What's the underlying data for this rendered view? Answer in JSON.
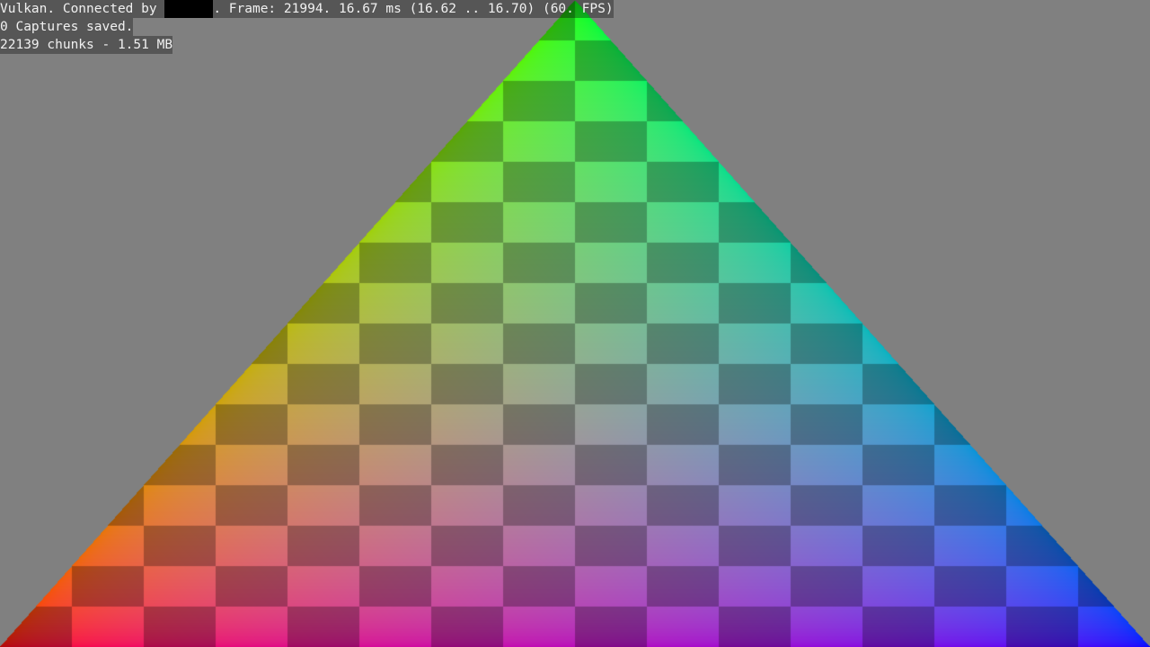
{
  "overlay": {
    "line1_prefix": "Vulkan. Connected by ",
    "line1_suffix": ". Frame: 21994. 16.67 ms (16.62 .. 16.70) (60. FPS)",
    "line2": "0 Captures saved.",
    "line3": "22139 chunks - 1.51 MB"
  },
  "scene": {
    "background": "#808080",
    "vertex_colors": {
      "top": "#00ff00",
      "bottom_left": "#ff0000",
      "bottom_right": "#0000ff"
    }
  }
}
